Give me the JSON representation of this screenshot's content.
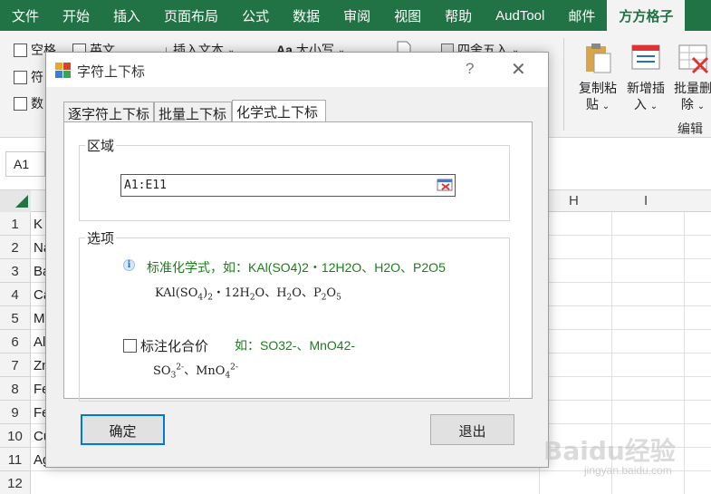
{
  "ribbon": {
    "tabs": [
      "文件",
      "开始",
      "插入",
      "页面布局",
      "公式",
      "数据",
      "审阅",
      "视图",
      "帮助",
      "AudTool",
      "邮件",
      "方方格子"
    ],
    "active_tab": "方方格子",
    "cmd_space": "空格",
    "cmd_english": "英文",
    "cmd_insert_text": "插入文本",
    "cmd_case": "大小写",
    "cmd_round": "四舍五入",
    "cmd_symbol": "符",
    "cmd_number": "数",
    "copy_paste_line1": "复制粘",
    "copy_paste_line2": "贴",
    "new_insert_line1": "新增插",
    "new_insert_line2": "入",
    "batch_delete_line1": "批量删",
    "batch_delete_line2": "除",
    "group_edit": "编辑"
  },
  "formula_bar": {
    "name_box": "A1"
  },
  "grid": {
    "visible_columns": [
      "H",
      "I"
    ],
    "rows": [
      "1",
      "2",
      "3",
      "4",
      "5",
      "6",
      "7",
      "8",
      "9",
      "10",
      "11",
      "12"
    ],
    "cells": [
      "K",
      "Na",
      "Ba",
      "Ca",
      "Mg",
      "Al",
      "Zn",
      "Fe",
      "Fe",
      "Cu",
      "Ag",
      ""
    ]
  },
  "dialog": {
    "title": "字符上下标",
    "help": "?",
    "close": "✕",
    "tabs": [
      "逐字符上下标",
      "批量上下标",
      "化学式上下标"
    ],
    "selected_tab": "化学式上下标",
    "region_label": "区域",
    "range_value": "A1:E11",
    "options_label": "选项",
    "standard_text": "标准化学式，如：KAl(SO4)2・12H2O、H2O、P2O5",
    "example1": {
      "p1": "KAl(SO",
      "s1": "4",
      "p2": ")",
      "s2": "2",
      "p3": "・12H",
      "s3": "2",
      "p4": "O、H",
      "s4": "2",
      "p5": "O、P",
      "s5": "2",
      "p6": "O",
      "s6": "5"
    },
    "valence_label": "标注化合价",
    "valence_hint": "如：SO32-、MnO42-",
    "example2": {
      "p1": "SO",
      "b1": "3",
      "u1": "2-",
      "p2": "、MnO",
      "b2": "4",
      "u2": "2-"
    },
    "ok": "确定",
    "exit": "退出"
  },
  "watermark": {
    "main": "Baidu经验",
    "sub": "jingyan.baidu.com"
  }
}
